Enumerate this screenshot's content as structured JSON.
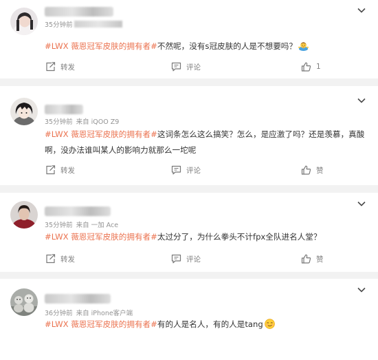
{
  "feed": {
    "posts": [
      {
        "time": "35分钟前",
        "source": "",
        "hashtag": "#LWX 薇恩冠军皮肤的拥有者#",
        "text": "不然呢，没有s冠皮肤的人是不想要吗？",
        "emoji": "shrug-emoji",
        "actions": {
          "repost": "转发",
          "comment": "评论",
          "like": "1"
        }
      },
      {
        "time": "35分钟前",
        "source": "来自 iQOO Z9",
        "hashtag": "#LWX 薇恩冠军皮肤的拥有者#",
        "text": "这词条怎么这么搞笑？怎么，是应激了吗？还是羡慕，真酸啊，没办法谁叫某人的影响力就那么一坨呢",
        "actions": {
          "repost": "转发",
          "comment": "评论",
          "like": "赞"
        }
      },
      {
        "time": "35分钟前",
        "source": "来自 一加 Ace",
        "hashtag": "#LWX 薇恩冠军皮肤的拥有者#",
        "text": "太过分了，为什么拳头不计fpx全队进名人堂？",
        "actions": {
          "repost": "转发",
          "comment": "评论",
          "like": "赞"
        }
      },
      {
        "time": "36分钟前",
        "source": "来自 iPhone客户端",
        "hashtag": "#LWX 薇恩冠军皮肤的拥有者#",
        "text": "有的人是名人，有的人是tang",
        "emoji": "smirk-emoji",
        "actions": {
          "repost": "转发",
          "comment": "评论",
          "like": "赞"
        }
      }
    ]
  },
  "icons": {
    "repost": "repost-icon",
    "comment": "comment-icon",
    "like": "thumbs-up-icon",
    "menu": "chevron-down-icon"
  },
  "colors": {
    "hashtag": "#eb7350",
    "text": "#333333",
    "meta": "#939393",
    "action": "#808080",
    "background": "#f2f2f2"
  }
}
